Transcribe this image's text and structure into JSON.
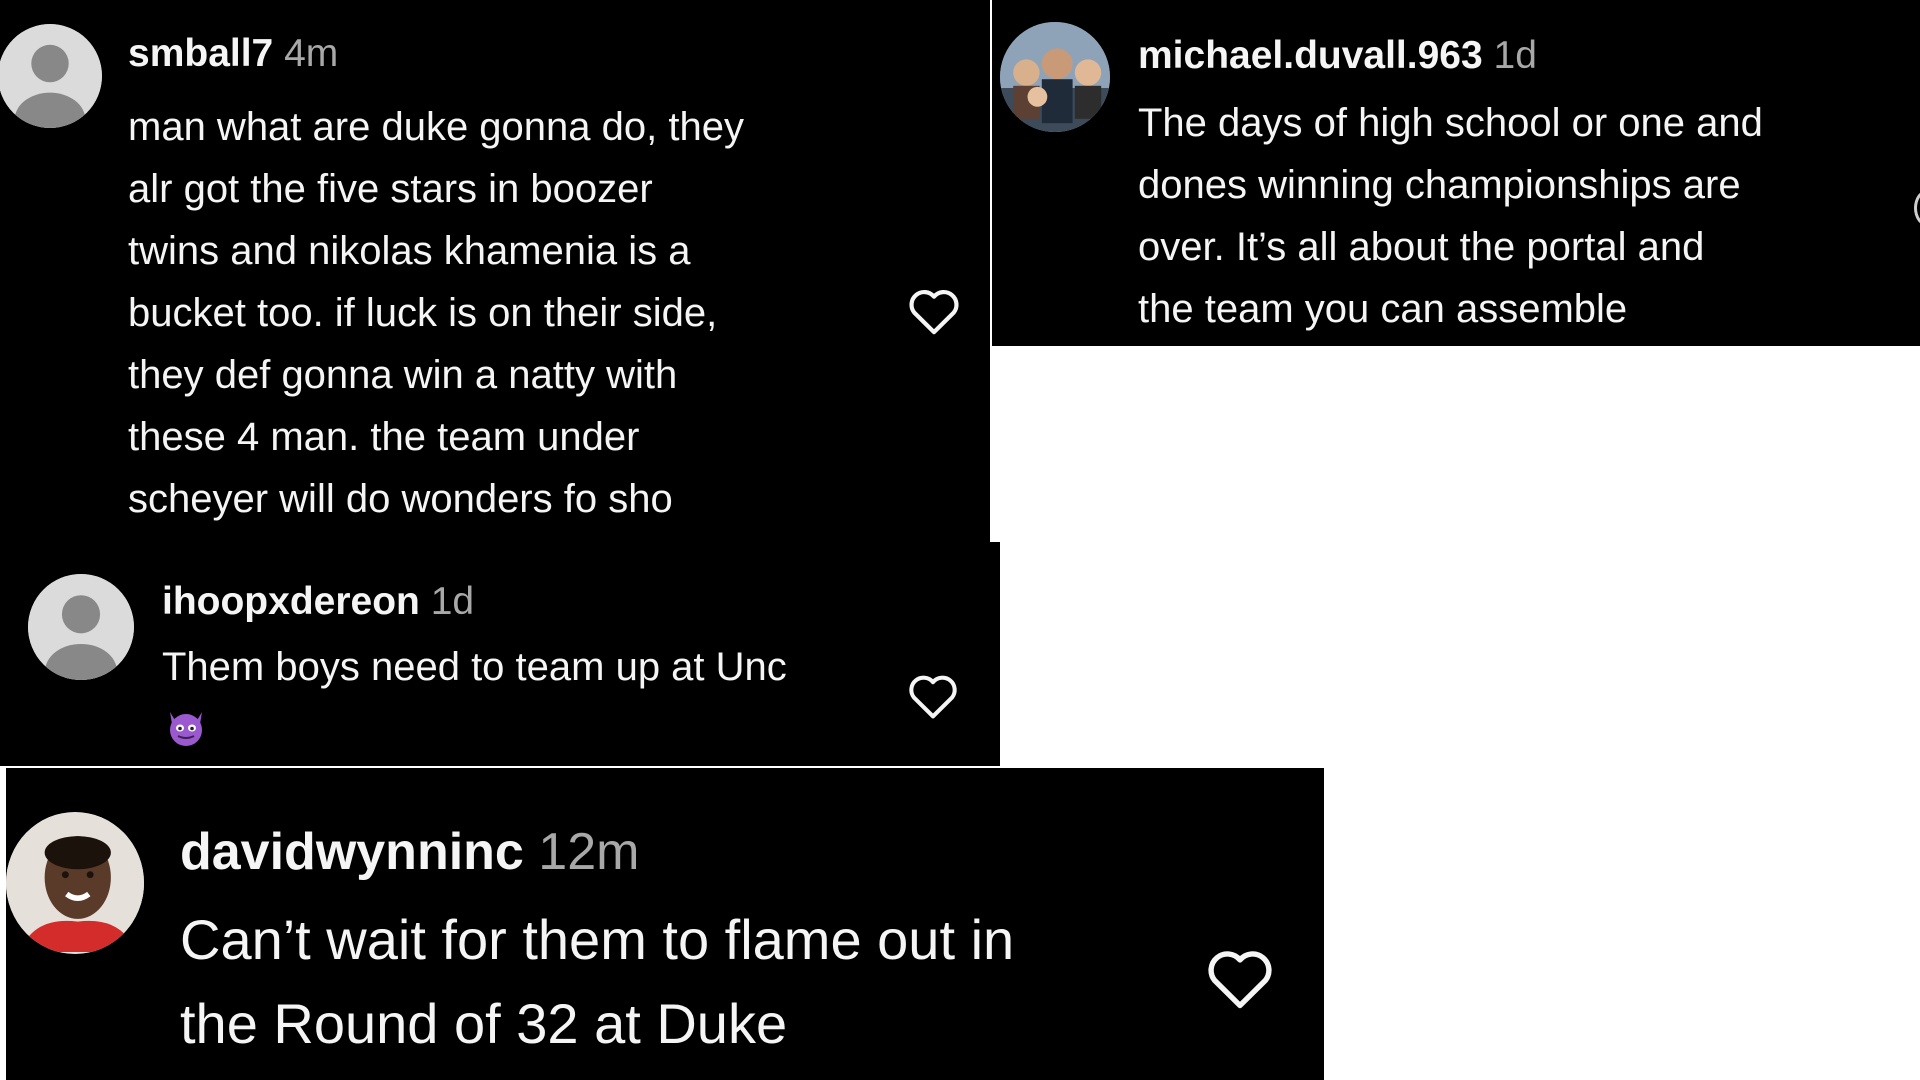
{
  "colors": {
    "panel_bg": "#000000",
    "text": "#f5f5f5",
    "timestamp": "#a8a8a8",
    "page_bg": "#ffffff"
  },
  "comments": [
    {
      "username": "smball7",
      "time": "4m",
      "avatar": "default-avatar-icon",
      "lines": [
        "man what are duke gonna do, they",
        "alr got the five stars in boozer",
        "twins and nikolas khamenia is a",
        "bucket too. if luck is on their side,",
        "they def gonna win a natty with",
        "these 4 man. the team under",
        "scheyer will do wonders fo sho"
      ],
      "like_icon": "heart-outline-icon"
    },
    {
      "username": "michael.duvall.963",
      "time": "1d",
      "avatar": "group-photo-avatar",
      "lines": [
        "The days of high school or one and",
        "dones winning championships are",
        "over. It’s all about the portal and",
        "the team you can assemble"
      ],
      "like_icon": "heart-outline-icon"
    },
    {
      "username": "ihoopxdereon",
      "time": "1d",
      "avatar": "default-avatar-icon",
      "lines": [
        "Them boys need to team up at Unc"
      ],
      "emoji": "😈",
      "like_icon": "heart-outline-icon"
    },
    {
      "username": "davidwynninc",
      "time": "12m",
      "avatar": "profile-photo-avatar",
      "lines": [
        "Can’t wait for them to flame out in",
        "the Round of 32 at Duke"
      ],
      "like_icon": "heart-outline-icon"
    }
  ]
}
